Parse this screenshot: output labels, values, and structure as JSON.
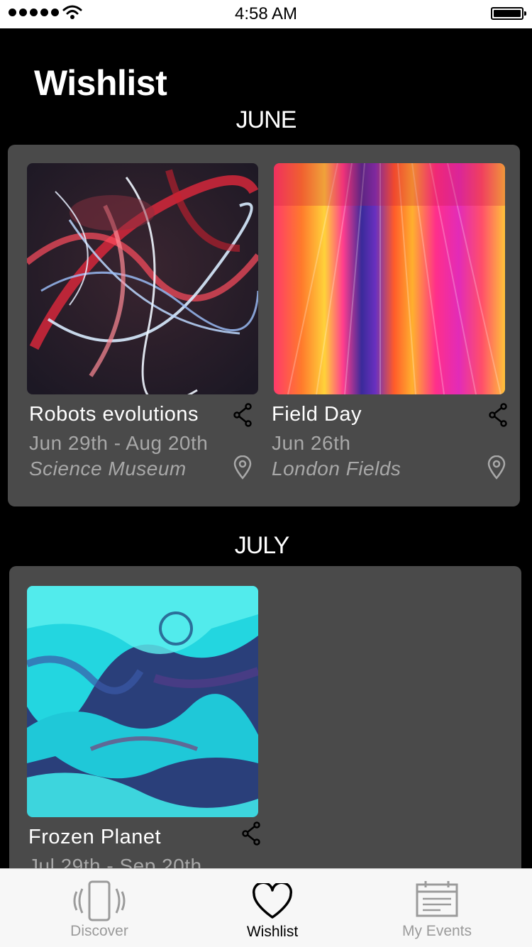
{
  "status_bar": {
    "time": "4:58 AM"
  },
  "page_title": "Wishlist",
  "sections": [
    {
      "month": "JUNE",
      "events": [
        {
          "title": "Robots evolutions",
          "date": "Jun 29th - Aug 20th",
          "venue": "Science Museum"
        },
        {
          "title": "Field Day",
          "date": "Jun 26th",
          "venue": "London Fields"
        }
      ]
    },
    {
      "month": "JULY",
      "events": [
        {
          "title": "Frozen Planet",
          "date": "Jul 29th - Sep 20th"
        }
      ]
    }
  ],
  "tab_bar": {
    "items": [
      {
        "label": "Discover",
        "icon": "phone-vibrate-icon"
      },
      {
        "label": "Wishlist",
        "icon": "heart-icon"
      },
      {
        "label": "My Events",
        "icon": "calendar-icon"
      }
    ],
    "active_color": "#000000",
    "inactive_color": "#9b9b9b"
  }
}
